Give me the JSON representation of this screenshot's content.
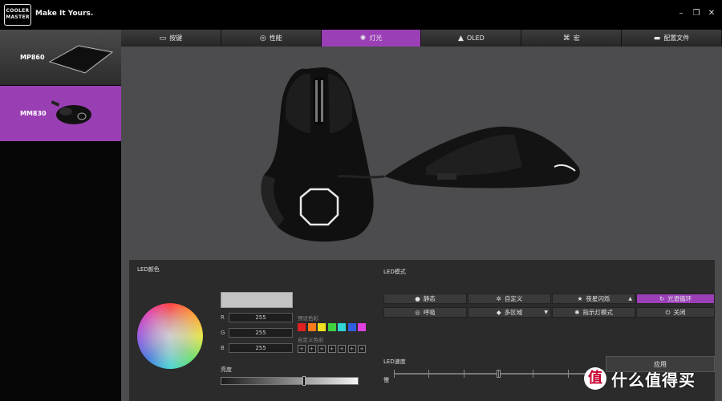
{
  "header": {
    "logo_text": "COOLER MASTER",
    "tagline": "Make It Yours.",
    "minimize_glyph": "–",
    "restore_glyph": "❐",
    "close_glyph": "✕"
  },
  "sidebar": {
    "devices": [
      {
        "name": "MP860",
        "selected": false
      },
      {
        "name": "MM830",
        "selected": true
      }
    ]
  },
  "tabs": [
    {
      "label": "按键",
      "icon": "mouse-icon"
    },
    {
      "label": "性能",
      "icon": "gauge-icon"
    },
    {
      "label": "灯光",
      "icon": "bulb-icon",
      "active": true
    },
    {
      "label": "OLED",
      "icon": "oled-icon"
    },
    {
      "label": "宏",
      "icon": "macro-icon"
    },
    {
      "label": "配置文件",
      "icon": "folder-icon"
    }
  ],
  "led_color": {
    "title": "LED颜色",
    "swatch_color": "#c4c4c4",
    "r_label": "R",
    "r_value": "255",
    "g_label": "G",
    "g_value": "255",
    "b_label": "B",
    "b_value": "255",
    "preset_label": "预设色彩",
    "preset_colors": [
      "#e02020",
      "#ff7a1a",
      "#f0e020",
      "#3fd23f",
      "#2fd6d6",
      "#2f5ee0",
      "#e040e0"
    ],
    "custom_label": "自定义色彩",
    "custom_glyph": "+",
    "brightness_label": "亮度",
    "brightness_value": 0.6
  },
  "led_mode": {
    "title": "LED模式",
    "modes": [
      {
        "label": "静态",
        "icon": "chat-icon"
      },
      {
        "label": "自定义",
        "icon": "gear-icon"
      },
      {
        "label": "夜星闪烁",
        "icon": "star-icon"
      },
      {
        "label": "光谱循环",
        "icon": "cycle-icon",
        "active": true
      },
      {
        "label": "呼吸",
        "icon": "gamepad-icon"
      },
      {
        "label": "多区域",
        "icon": "cube-icon"
      },
      {
        "label": "指示灯模式",
        "icon": "bulb-icon"
      },
      {
        "label": "关闭",
        "icon": "power-icon"
      }
    ],
    "dropdown_glyph": "▼",
    "arrow_glyph": "▲",
    "speed_label": "LED速度",
    "slow_label": "慢",
    "speed_value": 0.5,
    "apply_label": "应用"
  },
  "watermark": {
    "glyph": "值",
    "text": "什么值得买"
  }
}
